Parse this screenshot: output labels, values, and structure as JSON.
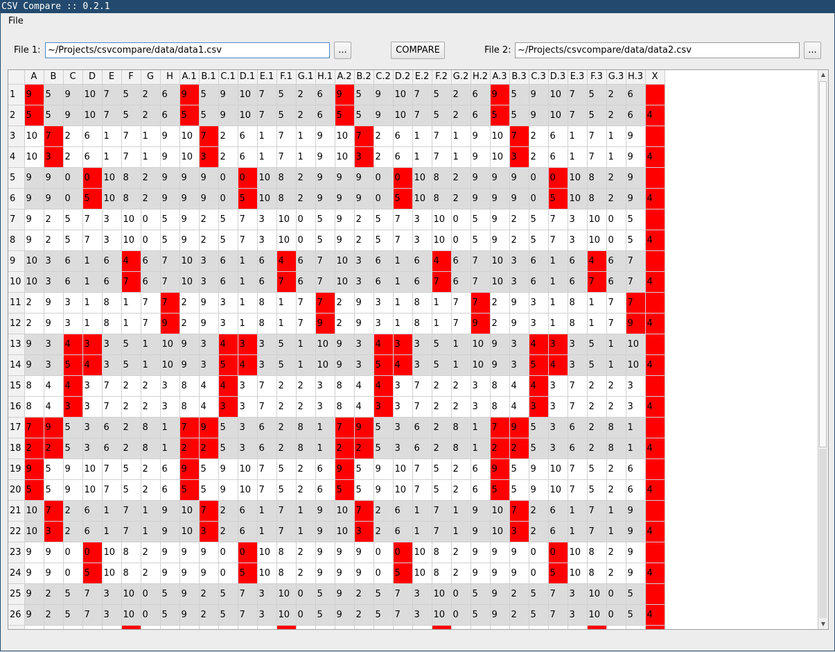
{
  "window": {
    "title": "CSV Compare :: 0.2.1"
  },
  "menu": {
    "file": "File"
  },
  "toolbar": {
    "file1_label": "File 1:",
    "file1_value": "~/Projects/csvcompare/data/data1.csv",
    "file1_browse": "...",
    "compare_label": "COMPARE",
    "file2_label": "File 2:",
    "file2_value": "~/Projects/csvcompare/data/data2.csv",
    "file2_browse": "..."
  },
  "colors": {
    "diff": "#ff0000",
    "shaded_row": "#dcdcdc",
    "title_bar": "#234a6e"
  },
  "table": {
    "columns": [
      "A",
      "B",
      "C",
      "D",
      "E",
      "F",
      "G",
      "H",
      "A.1",
      "B.1",
      "C.1",
      "D.1",
      "E.1",
      "F.1",
      "G.1",
      "H.1",
      "A.2",
      "B.2",
      "C.2",
      "D.2",
      "E.2",
      "F.2",
      "G.2",
      "H.2",
      "A.3",
      "B.3",
      "C.3",
      "D.3",
      "E.3",
      "F.3",
      "G.3",
      "H.3",
      "X"
    ],
    "row_labels": [
      "1",
      "2",
      "3",
      "4",
      "5",
      "6",
      "7",
      "8",
      "9",
      "10",
      "11",
      "12",
      "13",
      "14",
      "15",
      "16",
      "17",
      "18",
      "19",
      "20",
      "21",
      "22",
      "23",
      "24",
      "25",
      "26",
      ""
    ],
    "rows": [
      [
        "9",
        "5",
        "9",
        "10",
        "7",
        "5",
        "2",
        "6",
        "9",
        "5",
        "9",
        "10",
        "7",
        "5",
        "2",
        "6",
        "9",
        "5",
        "9",
        "10",
        "7",
        "5",
        "2",
        "6",
        "9",
        "5",
        "9",
        "10",
        "7",
        "5",
        "2",
        "6",
        ""
      ],
      [
        "5",
        "5",
        "9",
        "10",
        "7",
        "5",
        "2",
        "6",
        "5",
        "5",
        "9",
        "10",
        "7",
        "5",
        "2",
        "6",
        "5",
        "5",
        "9",
        "10",
        "7",
        "5",
        "2",
        "6",
        "5",
        "5",
        "9",
        "10",
        "7",
        "5",
        "2",
        "6",
        "4"
      ],
      [
        "10",
        "7",
        "2",
        "6",
        "1",
        "7",
        "1",
        "9",
        "10",
        "7",
        "2",
        "6",
        "1",
        "7",
        "1",
        "9",
        "10",
        "7",
        "2",
        "6",
        "1",
        "7",
        "1",
        "9",
        "10",
        "7",
        "2",
        "6",
        "1",
        "7",
        "1",
        "9",
        ""
      ],
      [
        "10",
        "3",
        "2",
        "6",
        "1",
        "7",
        "1",
        "9",
        "10",
        "3",
        "2",
        "6",
        "1",
        "7",
        "1",
        "9",
        "10",
        "3",
        "2",
        "6",
        "1",
        "7",
        "1",
        "9",
        "10",
        "3",
        "2",
        "6",
        "1",
        "7",
        "1",
        "9",
        "4"
      ],
      [
        "9",
        "9",
        "0",
        "0",
        "10",
        "8",
        "2",
        "9",
        "9",
        "9",
        "0",
        "0",
        "10",
        "8",
        "2",
        "9",
        "9",
        "9",
        "0",
        "0",
        "10",
        "8",
        "2",
        "9",
        "9",
        "9",
        "0",
        "0",
        "10",
        "8",
        "2",
        "9",
        ""
      ],
      [
        "9",
        "9",
        "0",
        "5",
        "10",
        "8",
        "2",
        "9",
        "9",
        "9",
        "0",
        "5",
        "10",
        "8",
        "2",
        "9",
        "9",
        "9",
        "0",
        "5",
        "10",
        "8",
        "2",
        "9",
        "9",
        "9",
        "0",
        "5",
        "10",
        "8",
        "2",
        "9",
        "4"
      ],
      [
        "9",
        "2",
        "5",
        "7",
        "3",
        "10",
        "0",
        "5",
        "9",
        "2",
        "5",
        "7",
        "3",
        "10",
        "0",
        "5",
        "9",
        "2",
        "5",
        "7",
        "3",
        "10",
        "0",
        "5",
        "9",
        "2",
        "5",
        "7",
        "3",
        "10",
        "0",
        "5",
        ""
      ],
      [
        "9",
        "2",
        "5",
        "7",
        "3",
        "10",
        "0",
        "5",
        "9",
        "2",
        "5",
        "7",
        "3",
        "10",
        "0",
        "5",
        "9",
        "2",
        "5",
        "7",
        "3",
        "10",
        "0",
        "5",
        "9",
        "2",
        "5",
        "7",
        "3",
        "10",
        "0",
        "5",
        "4"
      ],
      [
        "10",
        "3",
        "6",
        "1",
        "6",
        "4",
        "6",
        "7",
        "10",
        "3",
        "6",
        "1",
        "6",
        "4",
        "6",
        "7",
        "10",
        "3",
        "6",
        "1",
        "6",
        "4",
        "6",
        "7",
        "10",
        "3",
        "6",
        "1",
        "6",
        "4",
        "6",
        "7",
        ""
      ],
      [
        "10",
        "3",
        "6",
        "1",
        "6",
        "7",
        "6",
        "7",
        "10",
        "3",
        "6",
        "1",
        "6",
        "7",
        "6",
        "7",
        "10",
        "3",
        "6",
        "1",
        "6",
        "7",
        "6",
        "7",
        "10",
        "3",
        "6",
        "1",
        "6",
        "7",
        "6",
        "7",
        "4"
      ],
      [
        "2",
        "9",
        "3",
        "1",
        "8",
        "1",
        "7",
        "7",
        "2",
        "9",
        "3",
        "1",
        "8",
        "1",
        "7",
        "7",
        "2",
        "9",
        "3",
        "1",
        "8",
        "1",
        "7",
        "7",
        "2",
        "9",
        "3",
        "1",
        "8",
        "1",
        "7",
        "7",
        ""
      ],
      [
        "2",
        "9",
        "3",
        "1",
        "8",
        "1",
        "7",
        "9",
        "2",
        "9",
        "3",
        "1",
        "8",
        "1",
        "7",
        "9",
        "2",
        "9",
        "3",
        "1",
        "8",
        "1",
        "7",
        "9",
        "2",
        "9",
        "3",
        "1",
        "8",
        "1",
        "7",
        "9",
        "4"
      ],
      [
        "9",
        "3",
        "4",
        "3",
        "3",
        "5",
        "1",
        "10",
        "9",
        "3",
        "4",
        "3",
        "3",
        "5",
        "1",
        "10",
        "9",
        "3",
        "4",
        "3",
        "3",
        "5",
        "1",
        "10",
        "9",
        "3",
        "4",
        "3",
        "3",
        "5",
        "1",
        "10",
        ""
      ],
      [
        "9",
        "3",
        "5",
        "4",
        "3",
        "5",
        "1",
        "10",
        "9",
        "3",
        "5",
        "4",
        "3",
        "5",
        "1",
        "10",
        "9",
        "3",
        "5",
        "4",
        "3",
        "5",
        "1",
        "10",
        "9",
        "3",
        "5",
        "4",
        "3",
        "5",
        "1",
        "10",
        "4"
      ],
      [
        "8",
        "4",
        "4",
        "3",
        "7",
        "2",
        "2",
        "3",
        "8",
        "4",
        "4",
        "3",
        "7",
        "2",
        "2",
        "3",
        "8",
        "4",
        "4",
        "3",
        "7",
        "2",
        "2",
        "3",
        "8",
        "4",
        "4",
        "3",
        "7",
        "2",
        "2",
        "3",
        ""
      ],
      [
        "8",
        "4",
        "3",
        "3",
        "7",
        "2",
        "2",
        "3",
        "8",
        "4",
        "3",
        "3",
        "7",
        "2",
        "2",
        "3",
        "8",
        "4",
        "3",
        "3",
        "7",
        "2",
        "2",
        "3",
        "8",
        "4",
        "3",
        "3",
        "7",
        "2",
        "2",
        "3",
        "4"
      ],
      [
        "7",
        "9",
        "5",
        "3",
        "6",
        "2",
        "8",
        "1",
        "7",
        "9",
        "5",
        "3",
        "6",
        "2",
        "8",
        "1",
        "7",
        "9",
        "5",
        "3",
        "6",
        "2",
        "8",
        "1",
        "7",
        "9",
        "5",
        "3",
        "6",
        "2",
        "8",
        "1",
        ""
      ],
      [
        "2",
        "2",
        "5",
        "3",
        "6",
        "2",
        "8",
        "1",
        "2",
        "2",
        "5",
        "3",
        "6",
        "2",
        "8",
        "1",
        "2",
        "2",
        "5",
        "3",
        "6",
        "2",
        "8",
        "1",
        "2",
        "2",
        "5",
        "3",
        "6",
        "2",
        "8",
        "1",
        "4"
      ],
      [
        "9",
        "5",
        "9",
        "10",
        "7",
        "5",
        "2",
        "6",
        "9",
        "5",
        "9",
        "10",
        "7",
        "5",
        "2",
        "6",
        "9",
        "5",
        "9",
        "10",
        "7",
        "5",
        "2",
        "6",
        "9",
        "5",
        "9",
        "10",
        "7",
        "5",
        "2",
        "6",
        ""
      ],
      [
        "5",
        "5",
        "9",
        "10",
        "7",
        "5",
        "2",
        "6",
        "5",
        "5",
        "9",
        "10",
        "7",
        "5",
        "2",
        "6",
        "5",
        "5",
        "9",
        "10",
        "7",
        "5",
        "2",
        "6",
        "5",
        "5",
        "9",
        "10",
        "7",
        "5",
        "2",
        "6",
        "4"
      ],
      [
        "10",
        "7",
        "2",
        "6",
        "1",
        "7",
        "1",
        "9",
        "10",
        "7",
        "2",
        "6",
        "1",
        "7",
        "1",
        "9",
        "10",
        "7",
        "2",
        "6",
        "1",
        "7",
        "1",
        "9",
        "10",
        "7",
        "2",
        "6",
        "1",
        "7",
        "1",
        "9",
        ""
      ],
      [
        "10",
        "3",
        "2",
        "6",
        "1",
        "7",
        "1",
        "9",
        "10",
        "3",
        "2",
        "6",
        "1",
        "7",
        "1",
        "9",
        "10",
        "3",
        "2",
        "6",
        "1",
        "7",
        "1",
        "9",
        "10",
        "3",
        "2",
        "6",
        "1",
        "7",
        "1",
        "9",
        "4"
      ],
      [
        "9",
        "9",
        "0",
        "0",
        "10",
        "8",
        "2",
        "9",
        "9",
        "9",
        "0",
        "0",
        "10",
        "8",
        "2",
        "9",
        "9",
        "9",
        "0",
        "0",
        "10",
        "8",
        "2",
        "9",
        "9",
        "9",
        "0",
        "0",
        "10",
        "8",
        "2",
        "9",
        ""
      ],
      [
        "9",
        "9",
        "0",
        "5",
        "10",
        "8",
        "2",
        "9",
        "9",
        "9",
        "0",
        "5",
        "10",
        "8",
        "2",
        "9",
        "9",
        "9",
        "0",
        "5",
        "10",
        "8",
        "2",
        "9",
        "9",
        "9",
        "0",
        "5",
        "10",
        "8",
        "2",
        "9",
        "4"
      ],
      [
        "9",
        "2",
        "5",
        "7",
        "3",
        "10",
        "0",
        "5",
        "9",
        "2",
        "5",
        "7",
        "3",
        "10",
        "0",
        "5",
        "9",
        "2",
        "5",
        "7",
        "3",
        "10",
        "0",
        "5",
        "9",
        "2",
        "5",
        "7",
        "3",
        "10",
        "0",
        "5",
        ""
      ],
      [
        "9",
        "2",
        "5",
        "7",
        "3",
        "10",
        "0",
        "5",
        "9",
        "2",
        "5",
        "7",
        "3",
        "10",
        "0",
        "5",
        "9",
        "2",
        "5",
        "7",
        "3",
        "10",
        "0",
        "5",
        "9",
        "2",
        "5",
        "7",
        "3",
        "10",
        "0",
        "5",
        "4"
      ],
      [
        "",
        "",
        "",
        "",
        "",
        "",
        "",
        "",
        "",
        "",
        "",
        "",
        "",
        "",
        "",
        "",
        "",
        "",
        "",
        "",
        "",
        "",
        "",
        "",
        "",
        "",
        "",
        "",
        "",
        "",
        "",
        "",
        ""
      ]
    ],
    "shaded_rows": [
      0,
      1,
      4,
      5,
      8,
      9,
      12,
      13,
      16,
      17,
      20,
      21,
      24,
      25
    ],
    "diff_rows": [
      [
        0,
        8,
        16,
        24,
        32
      ],
      [
        0,
        8,
        16,
        24,
        32
      ],
      [
        1,
        9,
        17,
        25,
        32
      ],
      [
        1,
        9,
        17,
        25,
        32
      ],
      [
        3,
        11,
        19,
        27,
        32
      ],
      [
        3,
        11,
        19,
        27,
        32
      ],
      [
        32
      ],
      [
        32
      ],
      [
        5,
        13,
        21,
        29,
        32
      ],
      [
        5,
        13,
        21,
        29,
        32
      ],
      [
        7,
        15,
        23,
        31,
        32
      ],
      [
        7,
        15,
        23,
        31,
        32
      ],
      [
        2,
        3,
        10,
        11,
        18,
        19,
        26,
        27,
        32
      ],
      [
        2,
        3,
        10,
        11,
        18,
        19,
        26,
        27,
        32
      ],
      [
        2,
        10,
        18,
        26,
        32
      ],
      [
        2,
        10,
        18,
        26,
        32
      ],
      [
        0,
        1,
        8,
        9,
        16,
        17,
        24,
        25,
        32
      ],
      [
        0,
        1,
        8,
        9,
        16,
        17,
        24,
        25,
        32
      ],
      [
        0,
        8,
        16,
        24,
        32
      ],
      [
        0,
        8,
        16,
        24,
        32
      ],
      [
        1,
        9,
        17,
        25,
        32
      ],
      [
        1,
        9,
        17,
        25,
        32
      ],
      [
        3,
        11,
        19,
        27,
        32
      ],
      [
        3,
        11,
        19,
        27,
        32
      ],
      [
        32
      ],
      [
        32
      ],
      [
        5,
        13,
        21,
        29,
        32
      ]
    ]
  },
  "scrollbar": {
    "up": "▲",
    "down": "▼"
  }
}
